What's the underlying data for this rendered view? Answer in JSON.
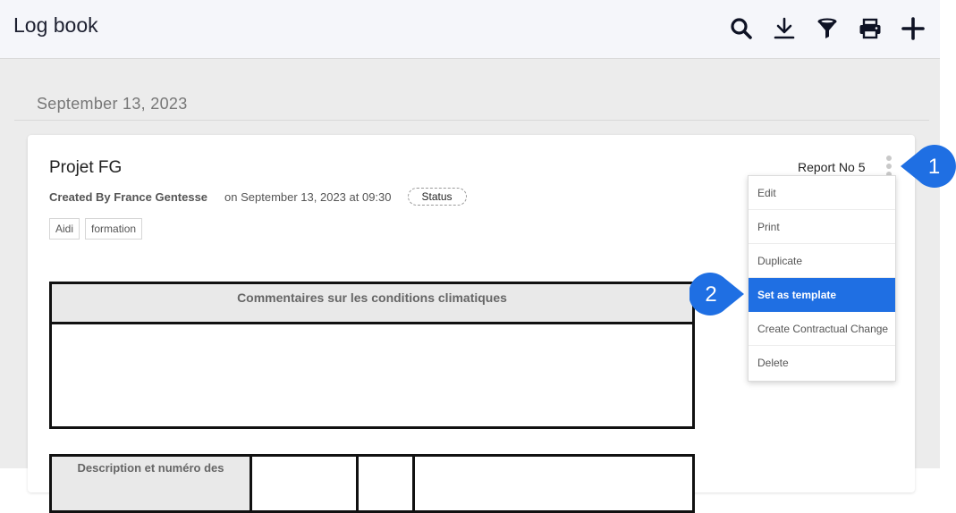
{
  "header": {
    "title": "Log book"
  },
  "toolbar": {
    "icons": [
      "search-icon",
      "download-icon",
      "filter-icon",
      "print-icon",
      "add-icon"
    ],
    "color": "#0e1224"
  },
  "date_group": {
    "label": "September 13, 2023"
  },
  "entry": {
    "project": "Projet FG",
    "created_by": "Created By France Gentesse",
    "created_on": "on September 13, 2023 at 09:30",
    "status": "Status",
    "tags": [
      "Aidi",
      "formation"
    ],
    "report_no": "Report No 5"
  },
  "tables": {
    "weather_header": "Commentaires sur les conditions climatiques",
    "second_header_partial": "Description et numéro des"
  },
  "context_menu": {
    "items": [
      "Edit",
      "Print",
      "Duplicate",
      "Set as template",
      "Create Contractual Change",
      "Delete"
    ],
    "active_index": 3,
    "active_color": "#1f6fe3"
  },
  "callouts": [
    {
      "number": "1",
      "color": "#1f6fe3"
    },
    {
      "number": "2",
      "color": "#1f6fe3"
    }
  ]
}
